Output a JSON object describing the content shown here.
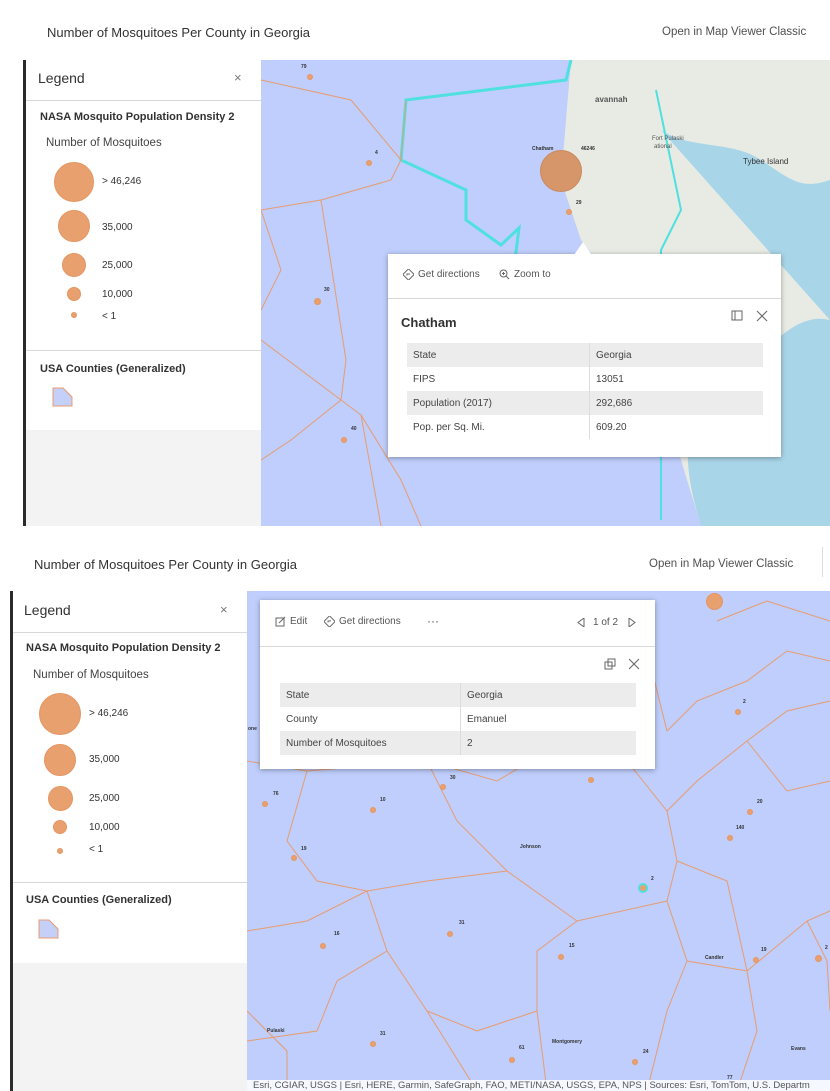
{
  "top": {
    "title": "Number of Mosquitoes Per County in Georgia",
    "open_link": "Open in Map Viewer Classic",
    "legend": {
      "header": "Legend",
      "close_glyph": "×",
      "layer1_title": "NASA Mosquito Population Density 2",
      "field_title": "Number of Mosquitoes",
      "classes": [
        {
          "label": "> 46,246"
        },
        {
          "label": "35,000"
        },
        {
          "label": "25,000"
        },
        {
          "label": "10,000"
        },
        {
          "label": "< 1"
        }
      ],
      "layer2_title": "USA Counties (Generalized)"
    },
    "map": {
      "place_labels": {
        "savannah": "avannah",
        "fort_pulaski": "Fort Pulaski",
        "fort_pulaski_2": "ational",
        "tybee": "Tybee Island",
        "chatham": "Chatham"
      },
      "point_values": {
        "p79": "79",
        "p4": "4",
        "p30": "30",
        "p40": "40",
        "p29": "29",
        "chatham_count": "46246"
      }
    },
    "popup": {
      "get_directions": "Get directions",
      "zoom_to": "Zoom to",
      "title": "Chatham",
      "rows": [
        {
          "key": "State",
          "value": "Georgia"
        },
        {
          "key": "FIPS",
          "value": "13051"
        },
        {
          "key": "Population (2017)",
          "value": "292,686"
        },
        {
          "key": "Pop. per Sq. Mi.",
          "value": "609.20"
        }
      ]
    }
  },
  "bottom": {
    "title": "Number of Mosquitoes Per County in Georgia",
    "open_link": "Open in Map Viewer Classic",
    "legend": {
      "header": "Legend",
      "close_glyph": "×",
      "layer1_title": "NASA Mosquito Population Density 2",
      "field_title": "Number of Mosquitoes",
      "classes": [
        {
          "label": "> 46,246"
        },
        {
          "label": "35,000"
        },
        {
          "label": "25,000"
        },
        {
          "label": "10,000"
        },
        {
          "label": "< 1"
        }
      ],
      "layer2_title": "USA Counties (Generalized)"
    },
    "map": {
      "county_labels": {
        "johnson": "Johnson",
        "candler": "Candler",
        "pulaski": "Pulaski",
        "montgomery": "Montgomery",
        "evans": "Evans",
        "one": "one"
      },
      "point_values": {
        "p2a": "2",
        "p20": "20",
        "p140": "140",
        "p30": "30",
        "p10": "10",
        "p76": "76",
        "p19": "19",
        "p2b": "2",
        "p16": "16",
        "p31a": "31",
        "p15": "15",
        "p19b": "19",
        "p2c": "2",
        "p31b": "31",
        "p61": "61",
        "p24": "24",
        "p77": "77",
        "p14": "14",
        "p10b": "10"
      },
      "attribution": "Esri, CGIAR, USGS | Esri, HERE, Garmin, SafeGraph, FAO, METI/NASA, USGS, EPA, NPS | Sources: Esri, TomTom, U.S. Departm"
    },
    "popup": {
      "edit": "Edit",
      "get_directions": "Get directions",
      "more": "···",
      "pager": "1 of 2",
      "rows": [
        {
          "key": "State",
          "value": "Georgia"
        },
        {
          "key": "County",
          "value": "Emanuel"
        },
        {
          "key": "Number of Mosquitoes",
          "value": "2"
        }
      ]
    }
  },
  "colors": {
    "map_fill": "#bfcefc",
    "county_line": "#e89c70",
    "symbol": "#e8a06e",
    "selection": "#4fe0e0",
    "land": "#e8ebe4",
    "water": "#a9d5e8"
  }
}
